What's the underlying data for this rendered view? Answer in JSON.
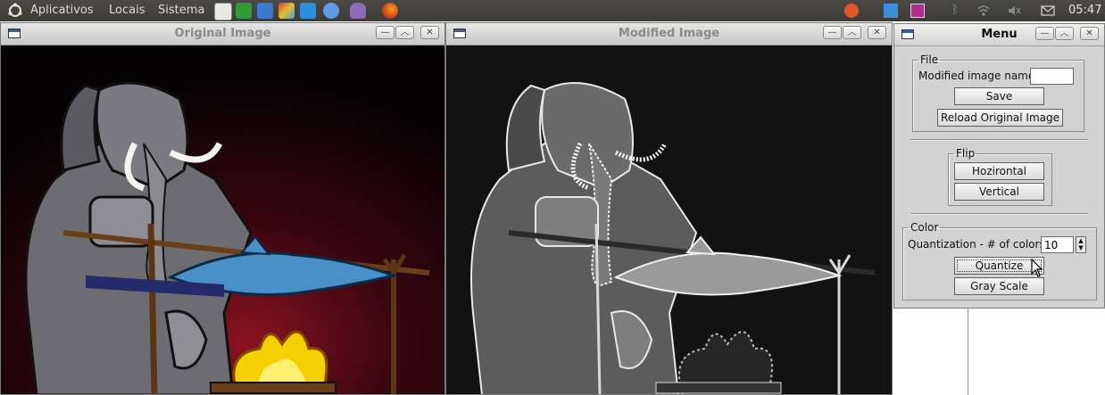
{
  "panel": {
    "menus": [
      "Aplicativos",
      "Locais",
      "Sistema"
    ],
    "launchers": [
      "text-editor-icon",
      "spreadsheet-icon",
      "document-icon",
      "paint-icon",
      "dropbox-icon",
      "chromium-icon",
      "pidgin-icon",
      "firefox-icon"
    ],
    "tray_icons": [
      "ubuntu-one-icon",
      "dropbox-tray-icon",
      "indicator-icon",
      "bluetooth-icon",
      "wifi-icon",
      "volume-icon",
      "mail-icon"
    ],
    "clock": "05:47"
  },
  "windows": {
    "original": {
      "title": "Original Image"
    },
    "modified": {
      "title": "Modified Image"
    },
    "menu": {
      "title": "Menu"
    }
  },
  "menu": {
    "file": {
      "legend": "File",
      "name_label": "Modified image name:",
      "name_value": "",
      "save_label": "Save",
      "reload_label": "Reload Original Image"
    },
    "flip": {
      "legend": "Flip",
      "horizontal_label": "Hozirontal",
      "vertical_label": "Vertical"
    },
    "color": {
      "legend": "Color",
      "quant_label": "Quantization - # of colors:",
      "quant_value": "10",
      "quantize_label": "Quantize",
      "gray_label": "Gray Scale"
    }
  },
  "colors": {
    "panel": "#3c3b37",
    "fish": "#4a90c8",
    "fire": "#f5d000"
  }
}
